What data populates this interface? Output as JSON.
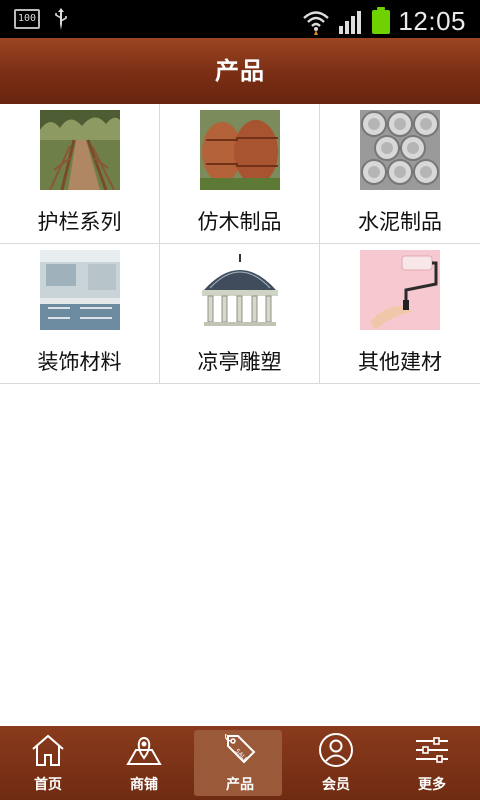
{
  "status_bar": {
    "battery_small_text": "100",
    "time": "12:05",
    "icons": [
      "battery-outline-icon",
      "usb-icon",
      "wifi-icon",
      "signal-icon",
      "battery-icon"
    ]
  },
  "header": {
    "title": "产品"
  },
  "products": [
    {
      "label": "护栏系列",
      "icon": "boardwalk-railing-photo"
    },
    {
      "label": "仿木制品",
      "icon": "wood-barrels-photo"
    },
    {
      "label": "水泥制品",
      "icon": "cement-pipes-photo"
    },
    {
      "label": "装饰材料",
      "icon": "kitchen-interior-photo"
    },
    {
      "label": "凉亭雕塑",
      "icon": "gazebo-photo"
    },
    {
      "label": "其他建材",
      "icon": "paint-roller-photo"
    }
  ],
  "tabbar": {
    "items": [
      {
        "label": "首页",
        "icon": "home-icon"
      },
      {
        "label": "商铺",
        "icon": "map-pin-icon"
      },
      {
        "label": "产品",
        "icon": "sale-tag-icon",
        "active": true
      },
      {
        "label": "会员",
        "icon": "user-icon"
      },
      {
        "label": "更多",
        "icon": "sliders-icon"
      }
    ]
  },
  "colors": {
    "header_brown": "#7a2e14",
    "tab_brown": "#6f2b12",
    "battery_green": "#6fd100"
  }
}
